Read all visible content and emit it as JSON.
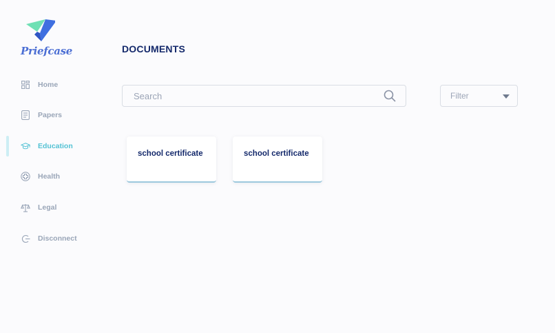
{
  "brand": {
    "name": "Priefcase"
  },
  "sidebar": {
    "items": [
      {
        "label": "Home",
        "icon": "grid-icon",
        "active": false
      },
      {
        "label": "Papers",
        "icon": "papers-icon",
        "active": false
      },
      {
        "label": "Education",
        "icon": "graduation-cap-icon",
        "active": true
      },
      {
        "label": "Health",
        "icon": "health-icon",
        "active": false
      },
      {
        "label": "Legal",
        "icon": "scales-icon",
        "active": false
      },
      {
        "label": "Disconnect",
        "icon": "disconnect-icon",
        "active": false
      }
    ]
  },
  "main": {
    "title": "DOCUMENTS",
    "search": {
      "placeholder": "Search",
      "value": ""
    },
    "filter": {
      "label": "Filter"
    },
    "documents": [
      {
        "title": "school certificate"
      },
      {
        "title": "school certificate"
      }
    ]
  },
  "colors": {
    "accent": "#54c2d4",
    "brand": "#4c6fd4",
    "title": "#14296b",
    "muted": "#9aa6b8"
  }
}
